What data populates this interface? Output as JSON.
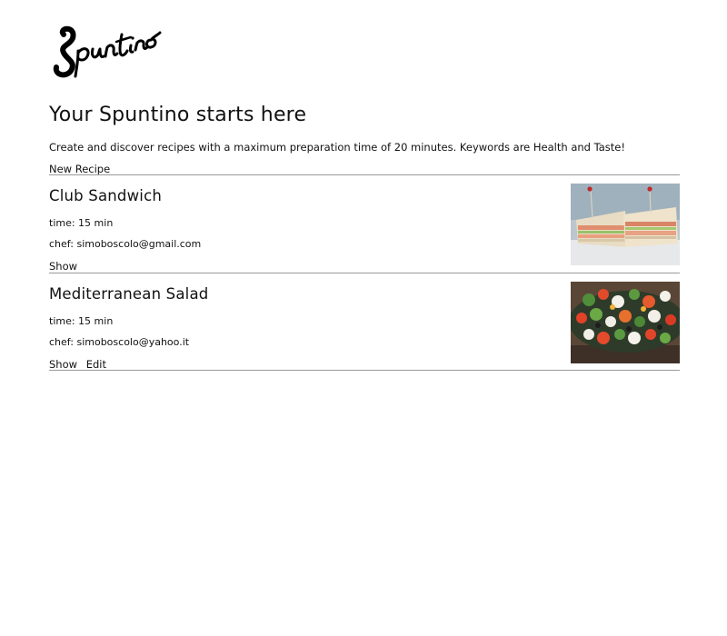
{
  "brand": {
    "logo_text": "Spuntino",
    "logo_icon": "spuntino-script-logo"
  },
  "hero": {
    "title": "Your Spuntino starts here",
    "intro": "Create and discover recipes with a maximum preparation time of 20 minutes. Keywords are Health and Taste!"
  },
  "actions": {
    "new_recipe_label": "New Recipe"
  },
  "recipes": [
    {
      "name": "Club Sandwich",
      "time": "time: 15 min",
      "chef": "chef: simoboscolo@gmail.com",
      "show_label": "Show",
      "image_icon": "club-sandwich-photo"
    },
    {
      "name": "Mediterranean Salad",
      "time": "time: 15 min",
      "chef": "chef: simoboscolo@yahoo.it",
      "show_label": "Show",
      "edit_label": "Edit",
      "image_icon": "mediterranean-salad-photo"
    }
  ],
  "colors": {
    "text": "#111111",
    "divider": "#9a9a9a",
    "background": "#ffffff"
  }
}
